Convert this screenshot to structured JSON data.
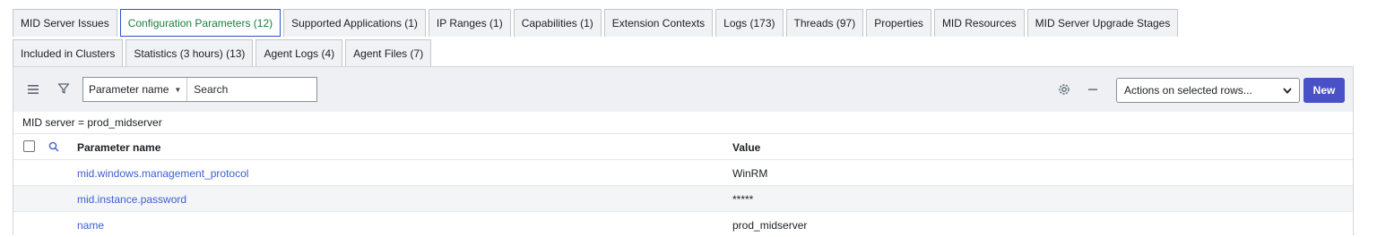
{
  "tabs_row1": [
    {
      "label": "MID Server Issues"
    },
    {
      "label": "Configuration Parameters (12)",
      "active": true
    },
    {
      "label": "Supported Applications (1)"
    },
    {
      "label": "IP Ranges (1)"
    },
    {
      "label": "Capabilities (1)"
    },
    {
      "label": "Extension Contexts"
    },
    {
      "label": "Logs (173)"
    },
    {
      "label": "Threads (97)"
    },
    {
      "label": "Properties"
    },
    {
      "label": "MID Resources"
    },
    {
      "label": "MID Server Upgrade Stages"
    }
  ],
  "tabs_row2": [
    {
      "label": "Included in Clusters"
    },
    {
      "label": "Statistics (3 hours) (13)"
    },
    {
      "label": "Agent Logs (4)"
    },
    {
      "label": "Agent Files (7)"
    }
  ],
  "toolbar": {
    "search_field": "Parameter name",
    "search_placeholder": "Search",
    "actions_label": "Actions on selected rows...",
    "new_label": "New"
  },
  "breadcrumb": "MID server = prod_midserver",
  "table": {
    "headers": {
      "name": "Parameter name",
      "value": "Value"
    },
    "rows": [
      {
        "name": "mid.windows.management_protocol",
        "value": "WinRM"
      },
      {
        "name": "mid.instance.password",
        "value": "*****"
      },
      {
        "name": "name",
        "value": "prod_midserver"
      }
    ]
  },
  "colors": {
    "accent": "#4a51c7",
    "link": "#3c5fd0",
    "active_tab_text": "#1a7e3e"
  }
}
